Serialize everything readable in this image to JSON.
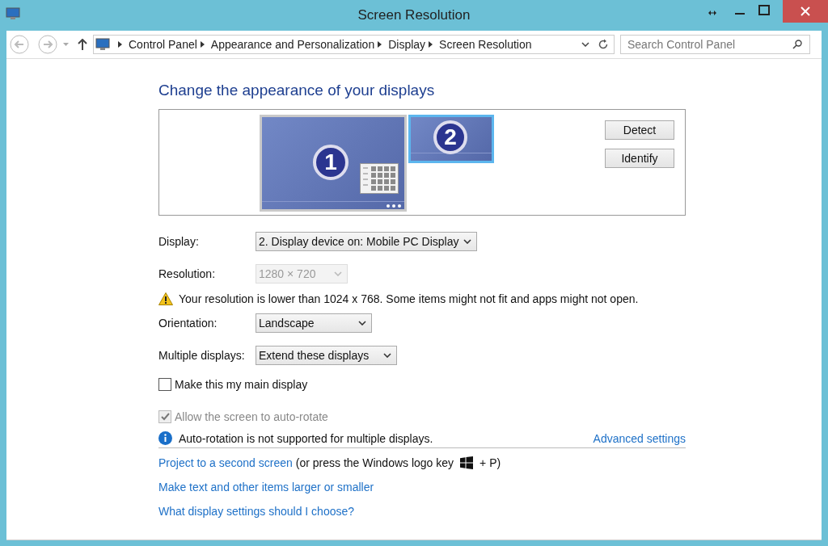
{
  "window": {
    "title": "Screen Resolution"
  },
  "address_bar": {
    "breadcrumbs": [
      "Control Panel",
      "Appearance and Personalization",
      "Display",
      "Screen Resolution"
    ],
    "search": {
      "placeholder": "Search Control Panel"
    }
  },
  "heading": "Change the appearance of your displays",
  "monitors": [
    {
      "label": "1",
      "selected": false,
      "kind": "large"
    },
    {
      "label": "2",
      "selected": true,
      "kind": "small"
    }
  ],
  "preview_buttons": [
    "Detect",
    "Identify"
  ],
  "settings": [
    {
      "label": "Display:",
      "value": "2. Display device on: Mobile PC Display",
      "disabled": false
    },
    {
      "label": "Resolution:",
      "value": "1280 × 720",
      "disabled": true
    },
    {
      "label": "Orientation:",
      "value": "Landscape",
      "disabled": false
    },
    {
      "label": "Multiple displays:",
      "value": "Extend these displays",
      "disabled": false
    }
  ],
  "warning": "Your resolution is lower than 1024 x 768. Some items might not fit and apps might not open.",
  "checkboxes": [
    {
      "label": "Make this my main display",
      "checked": false,
      "disabled": false
    },
    {
      "label": "Allow the screen to auto-rotate",
      "checked": true,
      "disabled": true
    }
  ],
  "info": "Auto-rotation is not supported for multiple displays.",
  "advanced_link": "Advanced settings",
  "project": {
    "link": "Project to a second screen",
    "note_before": "(or press the Windows logo key",
    "note_after": "+ P)"
  },
  "links": [
    "Make text and other items larger or smaller",
    "What display settings should I choose?"
  ]
}
